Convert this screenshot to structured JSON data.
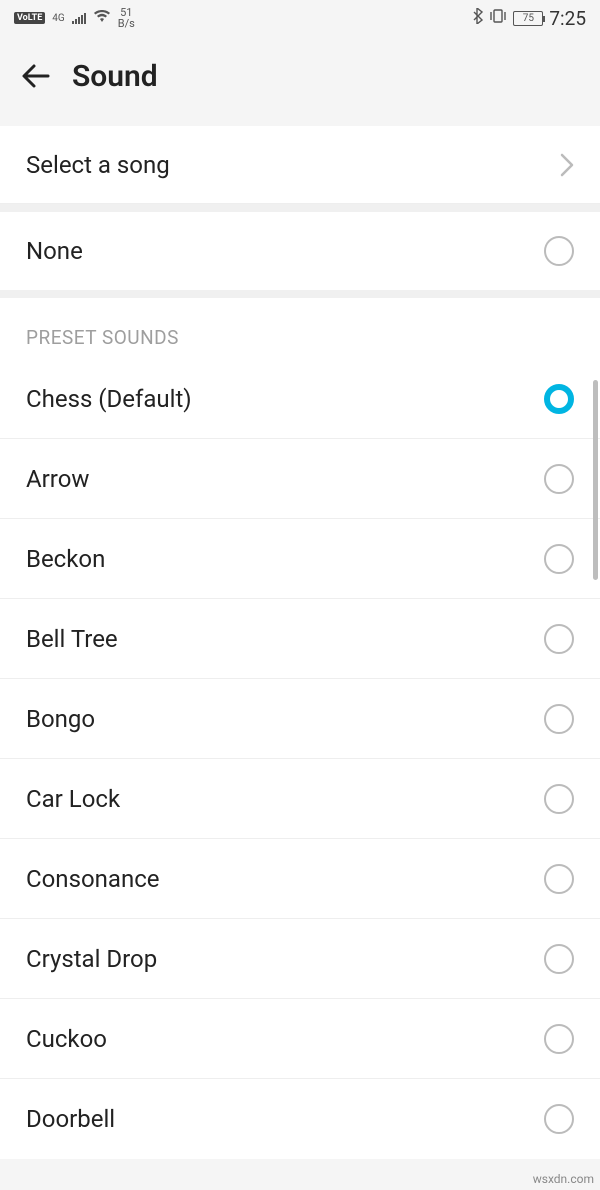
{
  "status": {
    "volte": "VoLTE",
    "network": "4G",
    "speed_value": "51",
    "speed_unit": "B/s",
    "battery": "75",
    "time": "7:25"
  },
  "header": {
    "title": "Sound"
  },
  "select_song": {
    "label": "Select a song"
  },
  "none_option": {
    "label": "None",
    "selected": false
  },
  "preset_section": {
    "header": "PRESET SOUNDS",
    "items": [
      {
        "label": "Chess (Default)",
        "selected": true
      },
      {
        "label": "Arrow",
        "selected": false
      },
      {
        "label": "Beckon",
        "selected": false
      },
      {
        "label": "Bell Tree",
        "selected": false
      },
      {
        "label": "Bongo",
        "selected": false
      },
      {
        "label": "Car Lock",
        "selected": false
      },
      {
        "label": "Consonance",
        "selected": false
      },
      {
        "label": "Crystal Drop",
        "selected": false
      },
      {
        "label": "Cuckoo",
        "selected": false
      },
      {
        "label": "Doorbell",
        "selected": false
      }
    ]
  },
  "watermark": "wsxdn.com"
}
